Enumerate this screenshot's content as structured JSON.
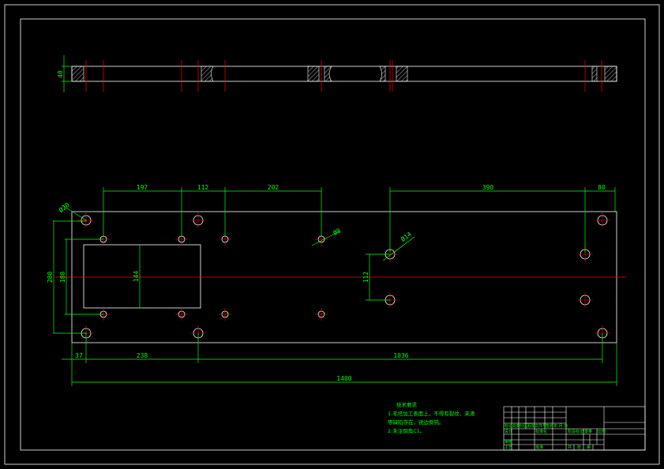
{
  "dimensions": {
    "top_view_thickness": "40",
    "hole_spacing_1": "197",
    "hole_spacing_2": "112",
    "hole_spacing_3": "202",
    "hole_spacing_4": "390",
    "hole_spacing_5": "80",
    "corner_hole_dia": "Ø20",
    "small_hole_dia": "Ø8",
    "mid_hole_dia": "Ø14",
    "overall_height": "280",
    "inner_height": "180",
    "window_height": "144",
    "vertical_spacing": "112",
    "left_offset": "37",
    "bottom_spacing_1": "238",
    "bottom_spacing_2": "1036",
    "overall_length": "1400"
  },
  "notes": {
    "title": "技术要求",
    "line1": "1.毛坯加工表面上，不得有裂纹、夹渣",
    "line2": "等缺陷存在，锐边倒钝。",
    "line3": "2.未注倒角C1。"
  },
  "title_block": {
    "label_a": "标记",
    "label_b": "处数",
    "label_c": "分区",
    "label_d": "更改文件号",
    "label_e": "签名",
    "label_f": "年.月.日",
    "label_g": "设计",
    "label_h": "标准化",
    "label_i": "阶段标记",
    "label_j": "重量",
    "label_k": "比例",
    "label_l": "审核",
    "label_m": "工艺",
    "label_n": "批准",
    "label_o": "共",
    "label_p": "张",
    "label_q": "第"
  },
  "colors": {
    "outline": "#ffffff",
    "dimension": "#00ff00",
    "centerline": "#ff0000",
    "background": "#000000"
  }
}
